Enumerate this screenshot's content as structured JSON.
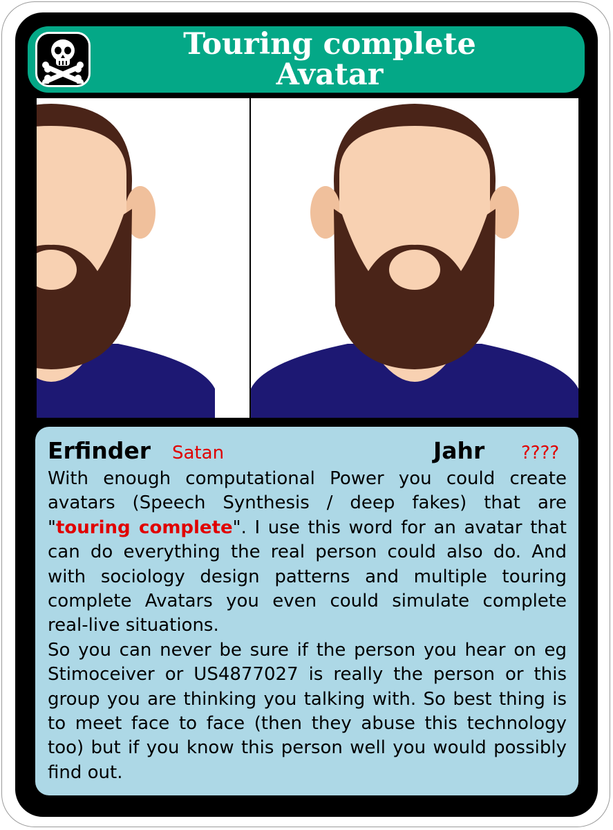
{
  "card": {
    "title_line1": "Touring complete",
    "title_line2": "Avatar",
    "badge_icon": "skull-and-crossbones-icon",
    "colors": {
      "title_bar": "#04a887",
      "info_panel": "#add8e6",
      "highlight": "#e00000",
      "hair": "#4a2418",
      "skin": "#f8d1b2",
      "shirt": "#1d1873"
    }
  },
  "info": {
    "inventor_label": "Erfinder",
    "inventor_value": "Satan",
    "year_label": "Jahr",
    "year_value": "????"
  },
  "description": {
    "p1_before": "With enough computational Power you could create avatars (Speech Synthesis / deep fakes) that are \"",
    "p1_highlight": "touring complete",
    "p1_after": "\". I use this word for an avatar that can do everything the real person could also do. And with sociology design patterns and multiple touring complete Avatars you even could simulate complete real-live situations.",
    "p2": "So you can never be sure if the person you hear on eg Stimoceiver or US4877027 is really the person or this group you are thinking you talking with. So best thing is to meet face to face (then they abuse this technology too) but if you know this person well you would possibly find out."
  }
}
